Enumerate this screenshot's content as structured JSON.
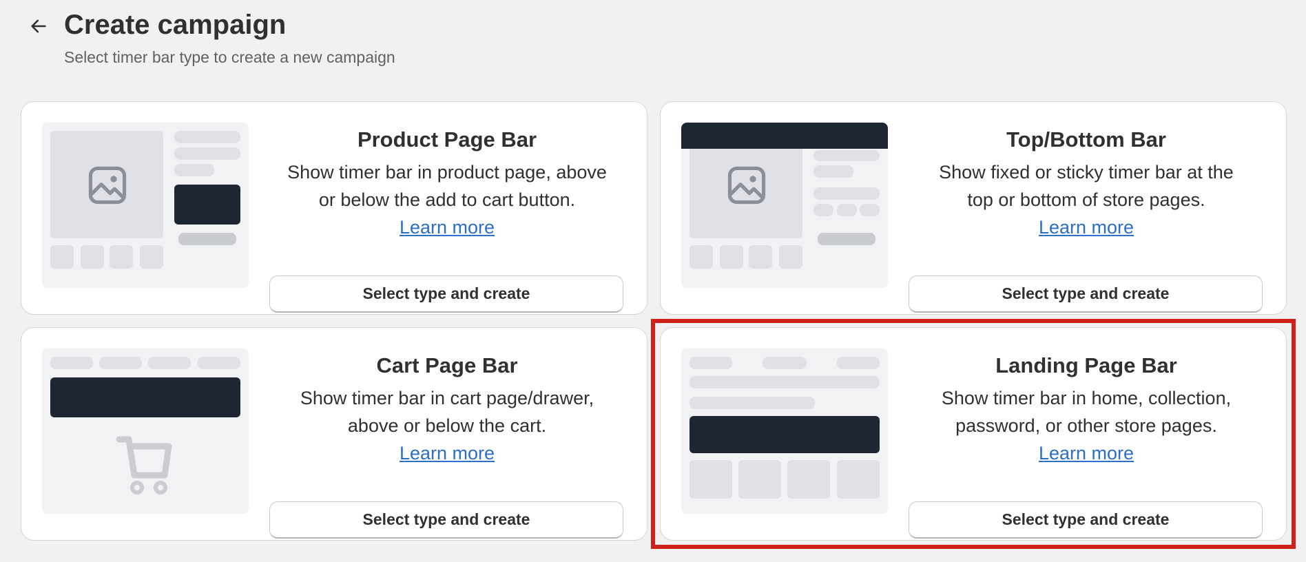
{
  "header": {
    "title": "Create campaign",
    "subtitle": "Select timer bar type to create a new campaign"
  },
  "cards": [
    {
      "title": "Product Page Bar",
      "desc_line1": "Show timer bar in product page, above",
      "desc_line2": "or below the add to cart button.",
      "learn_more": "Learn more",
      "button": "Select type and create"
    },
    {
      "title": "Top/Bottom Bar",
      "desc_line1": "Show fixed or sticky timer bar at the",
      "desc_line2": "top or bottom of store pages.",
      "learn_more": "Learn more",
      "button": "Select type and create"
    },
    {
      "title": "Cart Page Bar",
      "desc_line1": "Show timer bar in cart page/drawer,",
      "desc_line2": "above or below the cart.",
      "learn_more": "Learn more",
      "button": "Select type and create"
    },
    {
      "title": "Landing Page Bar",
      "desc_line1": "Show timer bar in home, collection,",
      "desc_line2": "password, or other store pages.",
      "learn_more": "Learn more",
      "button": "Select type and create"
    }
  ],
  "icons": {
    "back": "arrow-left-icon",
    "image": "image-icon",
    "cart": "cart-icon"
  },
  "colors": {
    "background": "#f1f1f1",
    "card": "#ffffff",
    "dark_bar": "#1f2633",
    "link": "#2c6ecb",
    "highlight": "#d0201a"
  }
}
